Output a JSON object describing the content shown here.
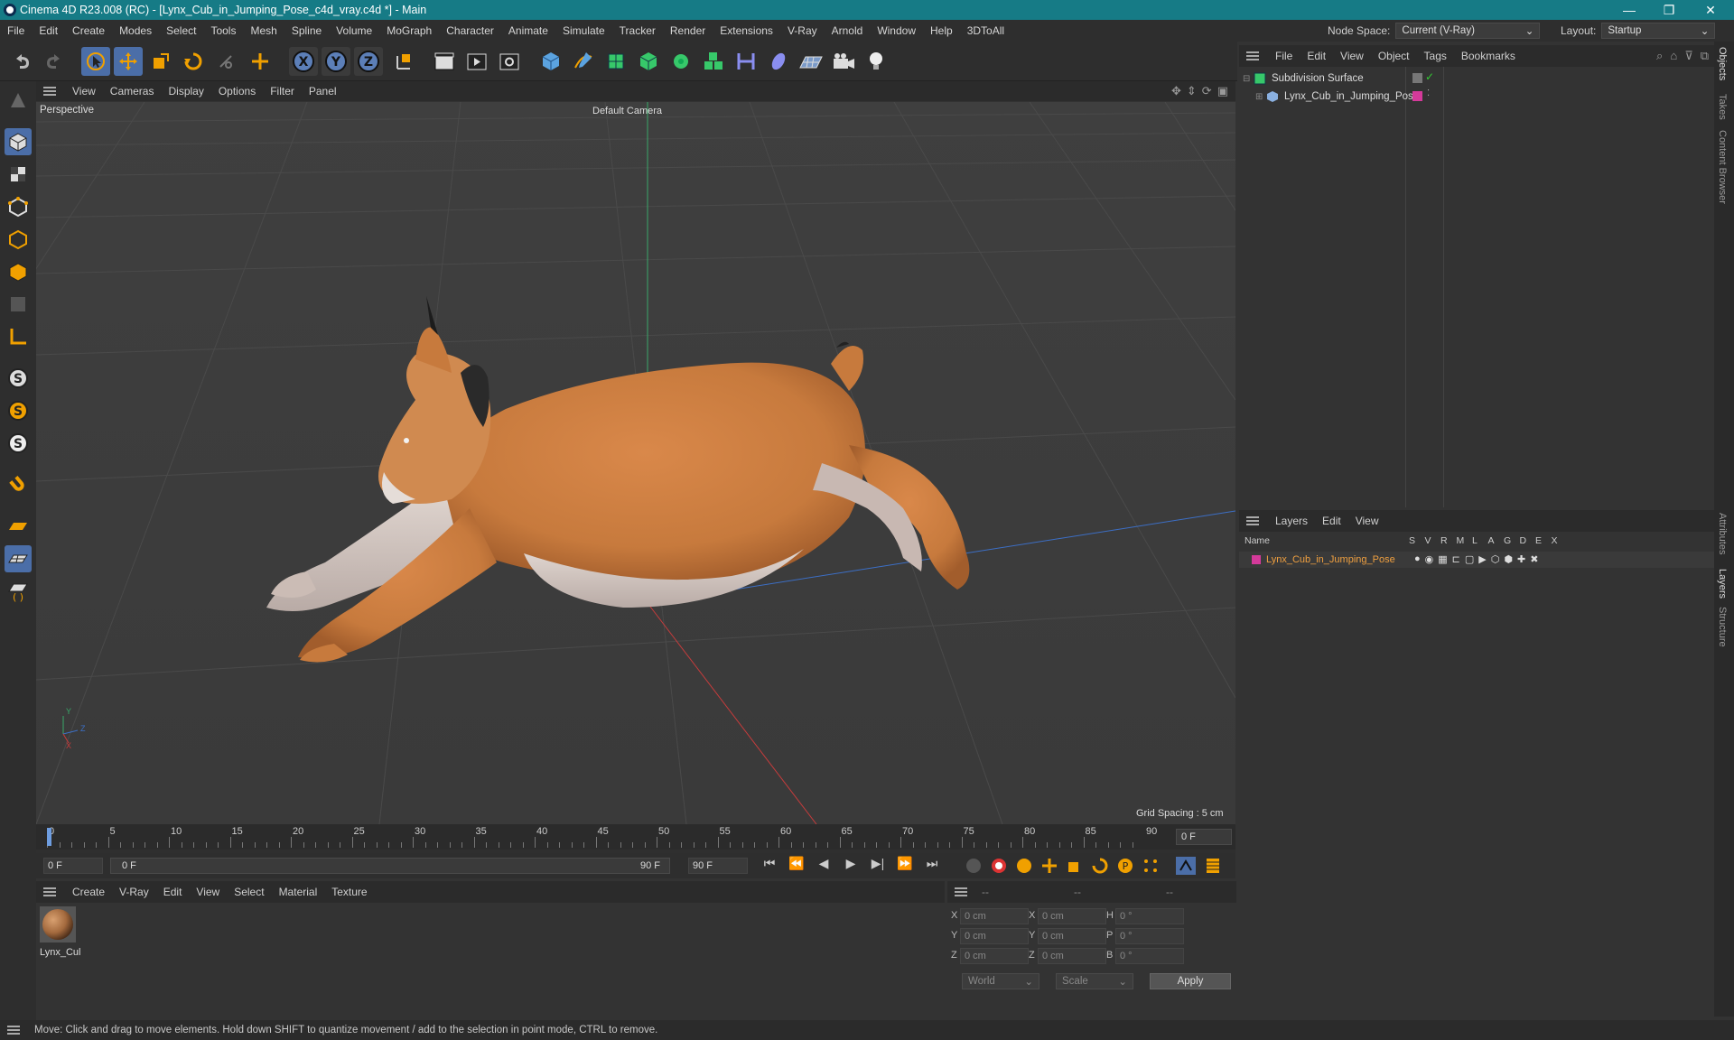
{
  "window": {
    "title": "Cinema 4D R23.008 (RC) - [Lynx_Cub_in_Jumping_Pose_c4d_vray.c4d *] - Main",
    "minimize": "—",
    "restore": "❐",
    "close": "✕"
  },
  "menubar": {
    "items": [
      "File",
      "Edit",
      "Create",
      "Modes",
      "Select",
      "Tools",
      "Mesh",
      "Spline",
      "Volume",
      "MoGraph",
      "Character",
      "Animate",
      "Simulate",
      "Tracker",
      "Render",
      "Extensions",
      "V-Ray",
      "Arnold",
      "Window",
      "Help",
      "3DToAll"
    ],
    "node_space_label": "Node Space:",
    "node_space_value": "Current (V-Ray)",
    "layout_label": "Layout:",
    "layout_value": "Startup"
  },
  "viewport": {
    "menu": [
      "View",
      "Cameras",
      "Display",
      "Options",
      "Filter",
      "Panel"
    ],
    "name": "Perspective",
    "camera": "Default Camera",
    "grid_spacing": "Grid Spacing : 5 cm",
    "axis_y": "Y",
    "axis_z": "Z",
    "axis_x": "X"
  },
  "timeline": {
    "ticks": [
      "0",
      "5",
      "10",
      "15",
      "20",
      "25",
      "30",
      "35",
      "40",
      "45",
      "50",
      "55",
      "60",
      "65",
      "70",
      "75",
      "80",
      "85",
      "90"
    ],
    "current_frame": "0 F",
    "start_field": "0 F",
    "range_start": "0 F",
    "range_end": "90 F",
    "end_field": "90 F"
  },
  "material_manager": {
    "menu": [
      "Create",
      "V-Ray",
      "Edit",
      "View",
      "Select",
      "Material",
      "Texture"
    ],
    "material_name": "Lynx_Cul"
  },
  "coordinates": {
    "header": [
      "--",
      "--",
      "--"
    ],
    "rows": [
      {
        "a": "X",
        "av": "0 cm",
        "b": "X",
        "bv": "0 cm",
        "c": "H",
        "cv": "0 °"
      },
      {
        "a": "Y",
        "av": "0 cm",
        "b": "Y",
        "bv": "0 cm",
        "c": "P",
        "cv": "0 °"
      },
      {
        "a": "Z",
        "av": "0 cm",
        "b": "Z",
        "bv": "0 cm",
        "c": "B",
        "cv": "0 °"
      }
    ],
    "mode1": "World",
    "mode2": "Scale",
    "apply": "Apply"
  },
  "object_manager": {
    "menu": [
      "File",
      "Edit",
      "View",
      "Object",
      "Tags",
      "Bookmarks"
    ],
    "objects": [
      "Subdivision Surface",
      "Lynx_Cub_in_Jumping_Pose"
    ]
  },
  "layer_manager": {
    "menu": [
      "Layers",
      "Edit",
      "View"
    ],
    "columns": [
      "Name",
      "S",
      "V",
      "R",
      "M",
      "L",
      "A",
      "G",
      "D",
      "E",
      "X"
    ],
    "layer": "Lynx_Cub_in_Jumping_Pose"
  },
  "side_tabs": [
    "Objects",
    "Takes",
    "Content Browser",
    "Attributes",
    "Layers",
    "Structure"
  ],
  "status": "Move: Click and drag to move elements. Hold down SHIFT to quantize movement / add to the selection in point mode, CTRL to remove.",
  "colors": {
    "titlebar": "#167b86",
    "accent": "#4b6ea8",
    "layer_color": "#d43a9a",
    "layer_text": "#f0a040"
  }
}
